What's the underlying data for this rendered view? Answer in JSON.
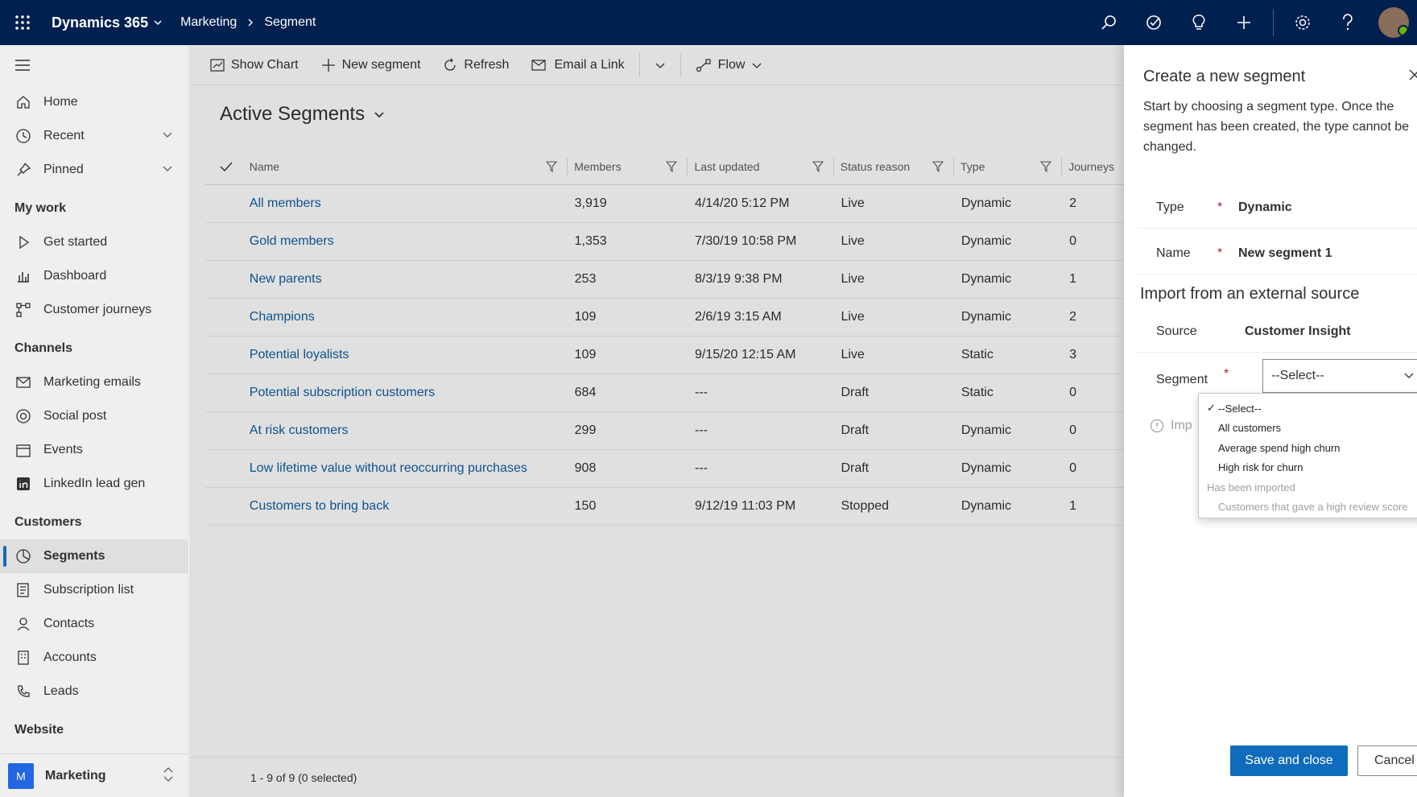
{
  "topbar": {
    "app_name": "Dynamics 365",
    "breadcrumb": [
      "Marketing",
      "Segment"
    ],
    "icons": [
      "search-icon",
      "assistant-icon",
      "lightbulb-icon",
      "plus-icon",
      "gear-icon",
      "help-icon"
    ]
  },
  "sidebar": {
    "items_top": [
      {
        "label": "Home",
        "icon": "home-icon"
      },
      {
        "label": "Recent",
        "icon": "clock-icon",
        "expandable": true
      },
      {
        "label": "Pinned",
        "icon": "pin-icon",
        "expandable": true
      }
    ],
    "groups": [
      {
        "title": "My work",
        "items": [
          {
            "label": "Get started",
            "icon": "play-icon"
          },
          {
            "label": "Dashboard",
            "icon": "dashboard-icon"
          },
          {
            "label": "Customer journeys",
            "icon": "journey-icon"
          }
        ]
      },
      {
        "title": "Channels",
        "items": [
          {
            "label": "Marketing emails",
            "icon": "mail-icon"
          },
          {
            "label": "Social post",
            "icon": "social-icon"
          },
          {
            "label": "Events",
            "icon": "calendar-icon"
          },
          {
            "label": "LinkedIn lead gen",
            "icon": "linkedin-icon"
          }
        ]
      },
      {
        "title": "Customers",
        "items": [
          {
            "label": "Segments",
            "icon": "segments-icon",
            "active": true
          },
          {
            "label": "Subscription list",
            "icon": "list-icon"
          },
          {
            "label": "Contacts",
            "icon": "person-icon"
          },
          {
            "label": "Accounts",
            "icon": "building-icon"
          },
          {
            "label": "Leads",
            "icon": "phone-icon"
          }
        ]
      },
      {
        "title": "Website",
        "items": []
      }
    ],
    "area": {
      "badge": "M",
      "label": "Marketing"
    }
  },
  "commandbar": {
    "show_chart": "Show Chart",
    "new_segment": "New segment",
    "refresh": "Refresh",
    "email_link": "Email a Link",
    "flow": "Flow"
  },
  "view": {
    "title": "Active Segments",
    "columns": [
      "Name",
      "Members",
      "Last updated",
      "Status reason",
      "Type",
      "Journeys"
    ],
    "rows": [
      [
        "All members",
        "3,919",
        "4/14/20 5:12 PM",
        "Live",
        "Dynamic",
        "2"
      ],
      [
        "Gold members",
        "1,353",
        "7/30/19 10:58 PM",
        "Live",
        "Dynamic",
        "0"
      ],
      [
        "New parents",
        "253",
        "8/3/19 9:38 PM",
        "Live",
        "Dynamic",
        "1"
      ],
      [
        "Champions",
        "109",
        "2/6/19 3:15 AM",
        "Live",
        "Dynamic",
        "2"
      ],
      [
        "Potential loyalists",
        "109",
        "9/15/20 12:15 AM",
        "Live",
        "Static",
        "3"
      ],
      [
        "Potential subscription customers",
        "684",
        "---",
        "Draft",
        "Static",
        "0"
      ],
      [
        "At risk customers",
        "299",
        "---",
        "Draft",
        "Dynamic",
        "0"
      ],
      [
        "Low lifetime value without reoccurring purchases",
        "908",
        "---",
        "Draft",
        "Dynamic",
        "0"
      ],
      [
        "Customers to bring back",
        "150",
        "9/12/19 11:03 PM",
        "Stopped",
        "Dynamic",
        "1"
      ]
    ],
    "footer": "1 - 9 of 9 (0 selected)"
  },
  "panel": {
    "title": "Create a new segment",
    "description": "Start by choosing a segment type. Once the segment has been created, the type cannot be changed.",
    "type_label": "Type",
    "type_value": "Dynamic",
    "name_label": "Name",
    "name_value": "New segment 1",
    "import_title": "Import from an external source",
    "source_label": "Source",
    "source_value": "Customer Insight",
    "segment_label": "Segment",
    "segment_value": "--Select--",
    "info_text": "Imp",
    "dropdown": {
      "selected": "--Select--",
      "options": [
        "All customers",
        "Average spend high churn",
        "High risk for churn"
      ],
      "group_label": "Has been imported",
      "group_options": [
        "Customers that gave a high review score"
      ]
    },
    "save_label": "Save and close",
    "cancel_label": "Cancel"
  },
  "colors": {
    "topbar": "#002050",
    "primary": "#0f6cbd",
    "link": "#115ea3",
    "required": "#a4262c"
  }
}
